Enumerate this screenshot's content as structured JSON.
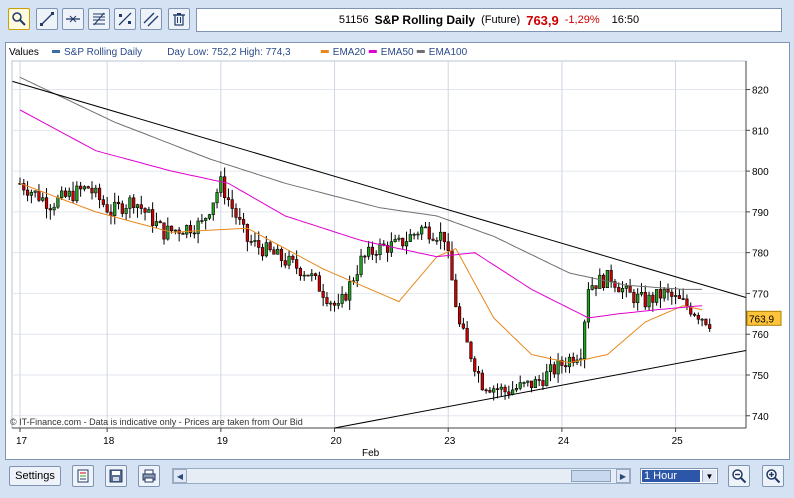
{
  "header": {
    "code": "51156",
    "instrument": "S&P Rolling Daily",
    "instrument_type": "(Future)",
    "last_price": "763,9",
    "change_pct": "-1,29%",
    "time": "16:50"
  },
  "toolbar": {
    "tools": [
      "zoom-cursor",
      "trendline",
      "horizontal-line",
      "fibonacci",
      "line-tools",
      "parallel-lines",
      "delete"
    ]
  },
  "legend": {
    "values_label": "Values",
    "items": [
      {
        "label": "S&P Rolling Daily",
        "color": "#3a6ea5"
      },
      {
        "label": "Day Low: 752,2 High: 774,3",
        "color": ""
      },
      {
        "label": "EMA20",
        "color": "#e8881c"
      },
      {
        "label": "EMA50",
        "color": "#e000d0"
      },
      {
        "label": "EMA100",
        "color": "#707070"
      }
    ]
  },
  "watermark": "© IT-Finance.com - Data is indicative only - Prices are taken from Our Bid",
  "bottom": {
    "settings_label": "Settings",
    "timeframe": "1 Hour"
  },
  "chart_data": {
    "type": "candlestick",
    "ylim": [
      737,
      827
    ],
    "yticks": [
      740,
      750,
      760,
      770,
      780,
      790,
      800,
      810,
      820
    ],
    "last_price_label": "763,9",
    "x_day_labels": [
      {
        "label": "17",
        "index": 0
      },
      {
        "label": "18",
        "index": 23
      },
      {
        "label": "19",
        "index": 53
      },
      {
        "label": "20",
        "index": 83
      },
      {
        "label": "23",
        "index": 113
      },
      {
        "label": "24",
        "index": 143
      },
      {
        "label": "25",
        "index": 173
      }
    ],
    "x_month_label": "Feb",
    "n_bars": 190,
    "series": [
      {
        "name": "S&P Rolling Daily",
        "kind": "candles",
        "up_color": "#22a022",
        "down_color": "#cc0000"
      },
      {
        "name": "EMA20",
        "color": "#e8881c",
        "points": [
          [
            0,
            797
          ],
          [
            20,
            790
          ],
          [
            40,
            785
          ],
          [
            60,
            786
          ],
          [
            80,
            776
          ],
          [
            100,
            768
          ],
          [
            110,
            779
          ],
          [
            115,
            781
          ],
          [
            125,
            764
          ],
          [
            135,
            755
          ],
          [
            145,
            753
          ],
          [
            155,
            755
          ],
          [
            165,
            763
          ],
          [
            175,
            767
          ],
          [
            180,
            766
          ]
        ]
      },
      {
        "name": "EMA50",
        "color": "#e000d0",
        "points": [
          [
            0,
            815
          ],
          [
            20,
            805
          ],
          [
            40,
            800
          ],
          [
            55,
            797
          ],
          [
            70,
            789
          ],
          [
            90,
            783
          ],
          [
            110,
            779
          ],
          [
            120,
            780
          ],
          [
            135,
            771
          ],
          [
            150,
            764
          ],
          [
            158,
            765
          ],
          [
            168,
            766
          ],
          [
            180,
            767
          ]
        ]
      },
      {
        "name": "EMA100",
        "color": "#707070",
        "points": [
          [
            0,
            823
          ],
          [
            25,
            812
          ],
          [
            50,
            803
          ],
          [
            70,
            797
          ],
          [
            95,
            791
          ],
          [
            110,
            789
          ],
          [
            125,
            784
          ],
          [
            145,
            775
          ],
          [
            160,
            772
          ],
          [
            175,
            771
          ],
          [
            180,
            771
          ]
        ]
      }
    ],
    "trendlines": [
      {
        "from": [
          -2,
          822
        ],
        "to": [
          194,
          769
        ]
      },
      {
        "from": [
          83,
          737
        ],
        "to": [
          194,
          756
        ]
      }
    ]
  }
}
